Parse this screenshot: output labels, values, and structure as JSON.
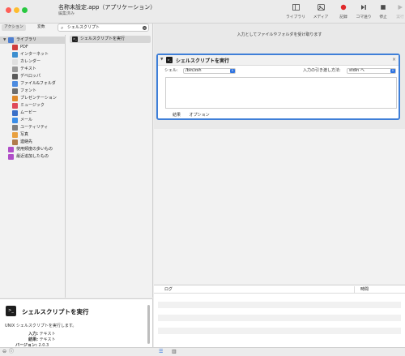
{
  "window": {
    "title": "名称未設定.app（アプリケーション）",
    "subtitle": "編集済み"
  },
  "toolbar": {
    "library_label": "ライブラリ",
    "media_label": "メディア",
    "record_label": "記録",
    "step_label": "コマ送り",
    "stop_label": "停止",
    "run_label": "実行"
  },
  "sidebar": {
    "tab_actions": "アクション",
    "tab_variables": "変数",
    "search_query": "シェルスクリプト",
    "library": [
      {
        "label": "ライブラリ",
        "icon": "library-icon",
        "color": "#4f7fd0"
      },
      {
        "label": "PDF",
        "icon": "pdf-icon",
        "color": "#d03d3d"
      },
      {
        "label": "インターネット",
        "icon": "internet-icon",
        "color": "#3d8fd0"
      },
      {
        "label": "カレンダー",
        "icon": "calendar-icon",
        "color": "#e0e0e0"
      },
      {
        "label": "テキスト",
        "icon": "text-icon",
        "color": "#9a9a9a"
      },
      {
        "label": "デベロッパ",
        "icon": "developer-icon",
        "color": "#5a5a5a"
      },
      {
        "label": "ファイル&フォルダ",
        "icon": "folder-icon",
        "color": "#4c8be0"
      },
      {
        "label": "フォント",
        "icon": "font-icon",
        "color": "#6e6e6e"
      },
      {
        "label": "プレゼンテーション",
        "icon": "presentation-icon",
        "color": "#e08a2a"
      },
      {
        "label": "ミュージック",
        "icon": "music-icon",
        "color": "#e04a5a"
      },
      {
        "label": "ムービー",
        "icon": "movie-icon",
        "color": "#3a6fc8"
      },
      {
        "label": "メール",
        "icon": "mail-icon",
        "color": "#3b8ee8"
      },
      {
        "label": "ユーティリティ",
        "icon": "utility-icon",
        "color": "#808080"
      },
      {
        "label": "写真",
        "icon": "photos-icon",
        "color": "#e8a040"
      },
      {
        "label": "連絡先",
        "icon": "contacts-icon",
        "color": "#b07b4b"
      },
      {
        "label": "使用頻度の多いもの",
        "icon": "frequent-folder-icon",
        "color": "#b04ec8"
      },
      {
        "label": "最近追加したもの",
        "icon": "recent-folder-icon",
        "color": "#b04ec8"
      }
    ],
    "actions": [
      {
        "label": "シェルスクリプトを実行"
      }
    ]
  },
  "description": {
    "title": "シェルスクリプトを実行",
    "text": "UNIX シェルスクリプトを実行します。",
    "input_label": "入力:",
    "input_value": "テキスト",
    "result_label": "結果:",
    "result_value": "テキスト",
    "version_label": "バージョン:",
    "version_value": "2.0.3"
  },
  "workflow": {
    "hint": "入力としてファイルやフォルダを受け取ります",
    "action": {
      "title": "シェルスクリプトを実行",
      "shell_label": "シェル:",
      "shell_value": "/bin/zsh",
      "input_method_label": "入力の引き渡し方法:",
      "input_method_value": "stdin へ",
      "tab_results": "結果",
      "tab_options": "オプション"
    }
  },
  "log": {
    "col_log": "ログ",
    "col_time": "時間"
  },
  "colors": {
    "accent": "#3f7fd8",
    "close_red": "#fe5f57",
    "minimize_yellow": "#febc2e",
    "zoom_green": "#28c840",
    "record_red": "#e0282a"
  }
}
